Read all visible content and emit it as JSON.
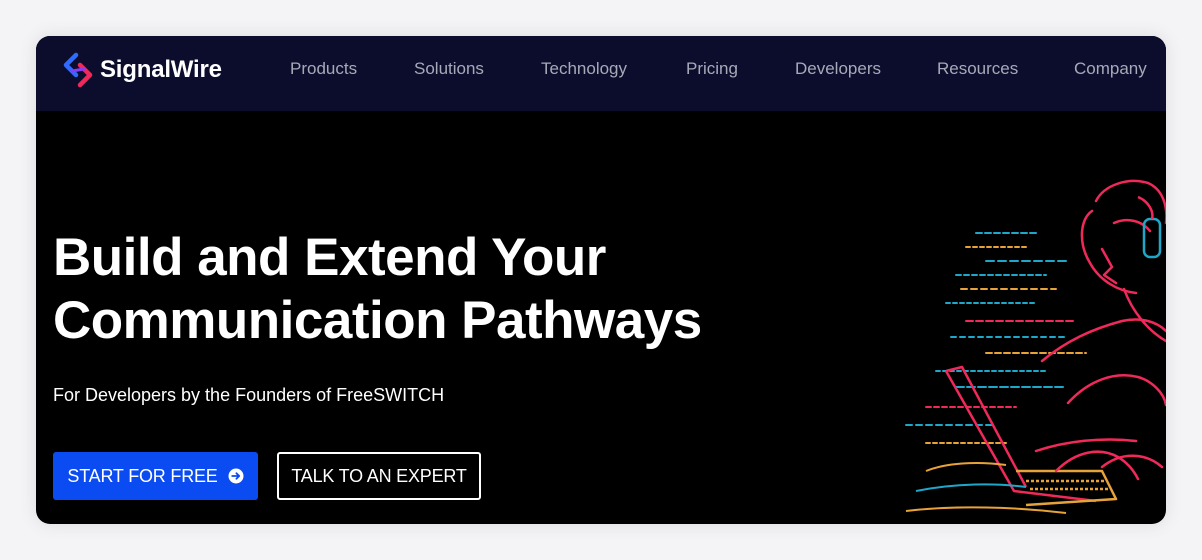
{
  "brand": {
    "name": "SignalWire"
  },
  "nav": {
    "items": [
      "Products",
      "Solutions",
      "Technology",
      "Pricing",
      "Developers",
      "Resources",
      "Company"
    ]
  },
  "hero": {
    "title_line1": "Build and Extend Your",
    "title_line2": "Communication Pathways",
    "subtitle": "For Developers by the Founders of FreeSWITCH",
    "primary_cta": "START FOR FREE",
    "secondary_cta": "TALK TO AN EXPERT"
  },
  "colors": {
    "nav_background": "#0c0d2c",
    "hero_background": "#000000",
    "primary_button": "#0a4bf2",
    "logo_blue": "#2f6bff",
    "logo_red": "#f0295a"
  },
  "icons": {
    "logo": "signalwire-logo-icon",
    "cta_arrow": "arrow-circle-right-icon",
    "hero_art": "developer-illustration"
  }
}
